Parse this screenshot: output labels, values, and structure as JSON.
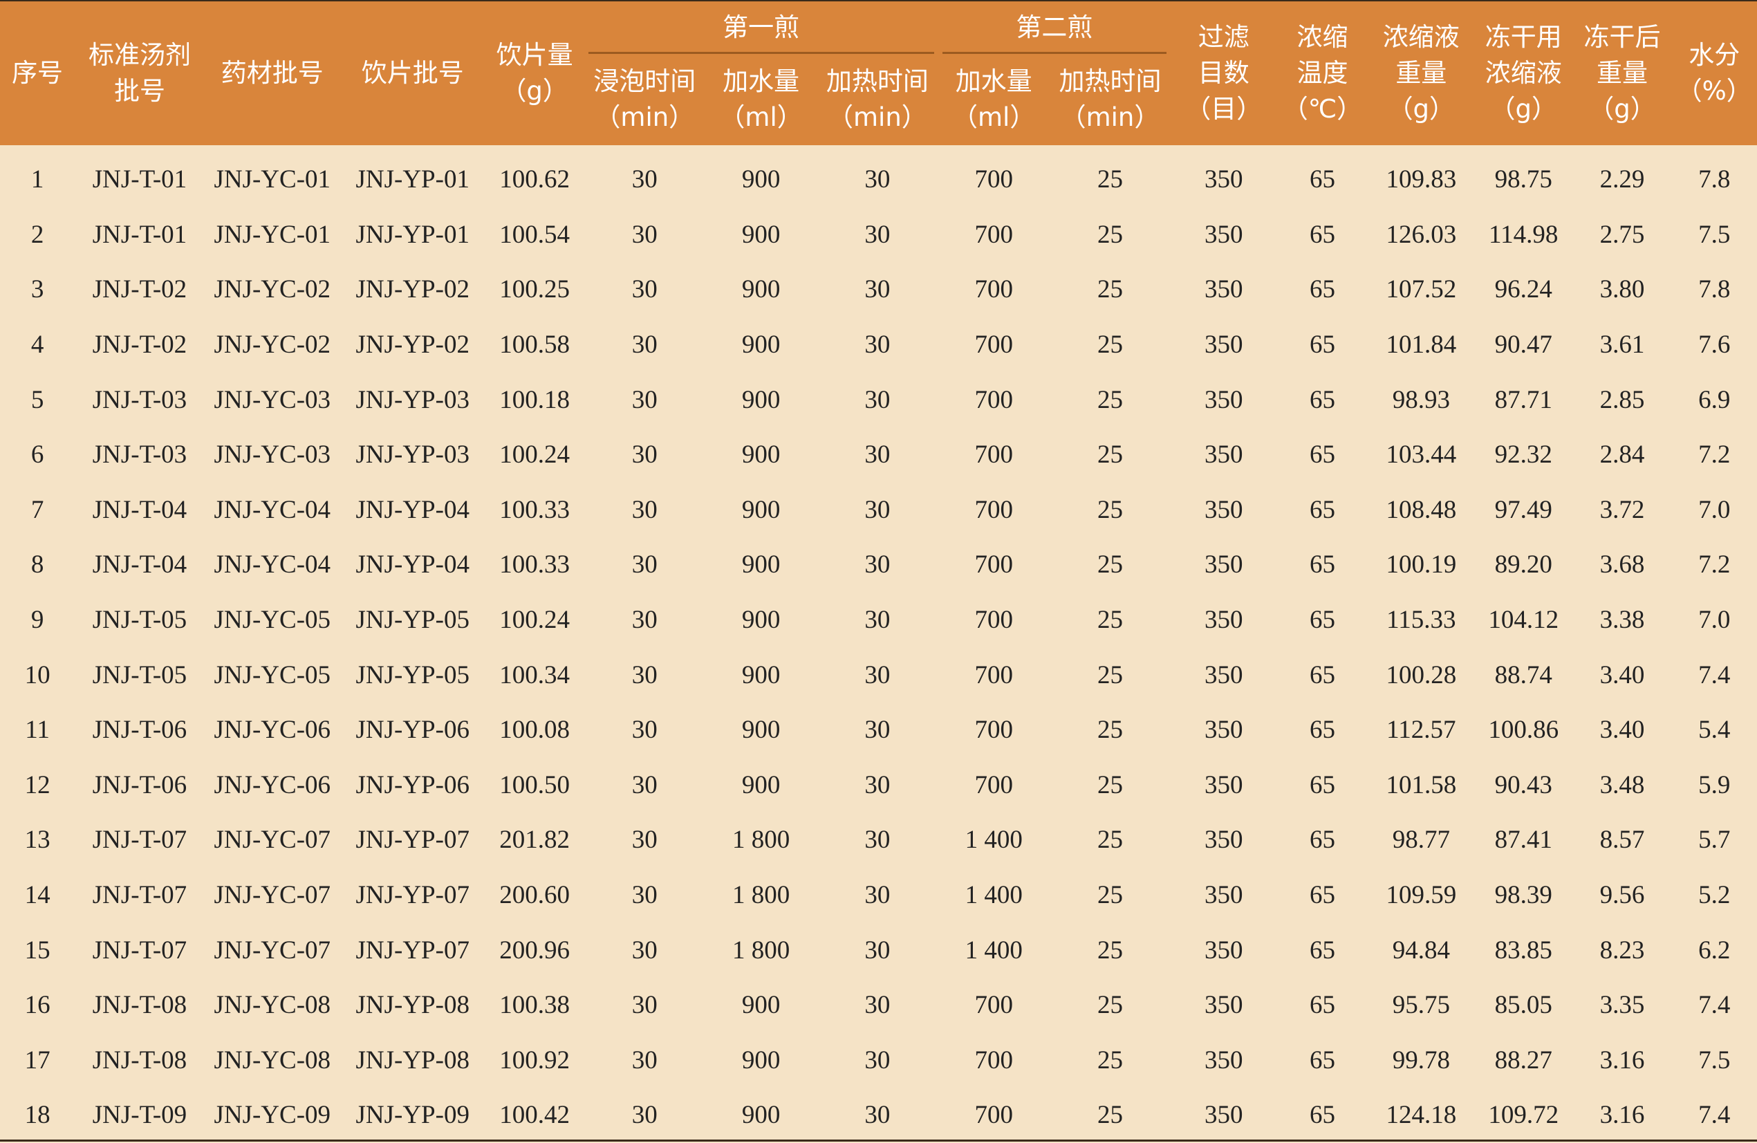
{
  "header": {
    "seq": "序号",
    "std_batch": [
      "标准汤剂",
      "批号"
    ],
    "herb_batch": "药材批号",
    "slice_batch": "饮片批号",
    "slice_amount": [
      "饮片量",
      "（g）"
    ],
    "first_decoction": "第一煎",
    "second_decoction": "第二煎",
    "soak_time": [
      "浸泡时间",
      "（min）"
    ],
    "water1": [
      "加水量",
      "（ml）"
    ],
    "heat1": [
      "加热时间",
      "（min）"
    ],
    "water2": [
      "加水量",
      "（ml）"
    ],
    "heat2": [
      "加热时间",
      "（min）"
    ],
    "filter_mesh": [
      "过滤",
      "目数",
      "（目）"
    ],
    "conc_temp": [
      "浓缩",
      "温度",
      "（℃）"
    ],
    "conc_weight": [
      "浓缩液",
      "重量",
      "（g）"
    ],
    "freeze_conc": [
      "冻干用",
      "浓缩液",
      "（g）"
    ],
    "after_freeze": [
      "冻干后",
      "重量",
      "（g）"
    ],
    "moisture": [
      "水分",
      "（%）"
    ]
  },
  "rows": [
    [
      "1",
      "JNJ-T-01",
      "JNJ-YC-01",
      "JNJ-YP-01",
      "100.62",
      "30",
      "900",
      "30",
      "700",
      "25",
      "350",
      "65",
      "109.83",
      "98.75",
      "2.29",
      "7.8"
    ],
    [
      "2",
      "JNJ-T-01",
      "JNJ-YC-01",
      "JNJ-YP-01",
      "100.54",
      "30",
      "900",
      "30",
      "700",
      "25",
      "350",
      "65",
      "126.03",
      "114.98",
      "2.75",
      "7.5"
    ],
    [
      "3",
      "JNJ-T-02",
      "JNJ-YC-02",
      "JNJ-YP-02",
      "100.25",
      "30",
      "900",
      "30",
      "700",
      "25",
      "350",
      "65",
      "107.52",
      "96.24",
      "3.80",
      "7.8"
    ],
    [
      "4",
      "JNJ-T-02",
      "JNJ-YC-02",
      "JNJ-YP-02",
      "100.58",
      "30",
      "900",
      "30",
      "700",
      "25",
      "350",
      "65",
      "101.84",
      "90.47",
      "3.61",
      "7.6"
    ],
    [
      "5",
      "JNJ-T-03",
      "JNJ-YC-03",
      "JNJ-YP-03",
      "100.18",
      "30",
      "900",
      "30",
      "700",
      "25",
      "350",
      "65",
      "98.93",
      "87.71",
      "2.85",
      "6.9"
    ],
    [
      "6",
      "JNJ-T-03",
      "JNJ-YC-03",
      "JNJ-YP-03",
      "100.24",
      "30",
      "900",
      "30",
      "700",
      "25",
      "350",
      "65",
      "103.44",
      "92.32",
      "2.84",
      "7.2"
    ],
    [
      "7",
      "JNJ-T-04",
      "JNJ-YC-04",
      "JNJ-YP-04",
      "100.33",
      "30",
      "900",
      "30",
      "700",
      "25",
      "350",
      "65",
      "108.48",
      "97.49",
      "3.72",
      "7.0"
    ],
    [
      "8",
      "JNJ-T-04",
      "JNJ-YC-04",
      "JNJ-YP-04",
      "100.33",
      "30",
      "900",
      "30",
      "700",
      "25",
      "350",
      "65",
      "100.19",
      "89.20",
      "3.68",
      "7.2"
    ],
    [
      "9",
      "JNJ-T-05",
      "JNJ-YC-05",
      "JNJ-YP-05",
      "100.24",
      "30",
      "900",
      "30",
      "700",
      "25",
      "350",
      "65",
      "115.33",
      "104.12",
      "3.38",
      "7.0"
    ],
    [
      "10",
      "JNJ-T-05",
      "JNJ-YC-05",
      "JNJ-YP-05",
      "100.34",
      "30",
      "900",
      "30",
      "700",
      "25",
      "350",
      "65",
      "100.28",
      "88.74",
      "3.40",
      "7.4"
    ],
    [
      "11",
      "JNJ-T-06",
      "JNJ-YC-06",
      "JNJ-YP-06",
      "100.08",
      "30",
      "900",
      "30",
      "700",
      "25",
      "350",
      "65",
      "112.57",
      "100.86",
      "3.40",
      "5.4"
    ],
    [
      "12",
      "JNJ-T-06",
      "JNJ-YC-06",
      "JNJ-YP-06",
      "100.50",
      "30",
      "900",
      "30",
      "700",
      "25",
      "350",
      "65",
      "101.58",
      "90.43",
      "3.48",
      "5.9"
    ],
    [
      "13",
      "JNJ-T-07",
      "JNJ-YC-07",
      "JNJ-YP-07",
      "201.82",
      "30",
      "1 800",
      "30",
      "1 400",
      "25",
      "350",
      "65",
      "98.77",
      "87.41",
      "8.57",
      "5.7"
    ],
    [
      "14",
      "JNJ-T-07",
      "JNJ-YC-07",
      "JNJ-YP-07",
      "200.60",
      "30",
      "1 800",
      "30",
      "1 400",
      "25",
      "350",
      "65",
      "109.59",
      "98.39",
      "9.56",
      "5.2"
    ],
    [
      "15",
      "JNJ-T-07",
      "JNJ-YC-07",
      "JNJ-YP-07",
      "200.96",
      "30",
      "1 800",
      "30",
      "1 400",
      "25",
      "350",
      "65",
      "94.84",
      "83.85",
      "8.23",
      "6.2"
    ],
    [
      "16",
      "JNJ-T-08",
      "JNJ-YC-08",
      "JNJ-YP-08",
      "100.38",
      "30",
      "900",
      "30",
      "700",
      "25",
      "350",
      "65",
      "95.75",
      "85.05",
      "3.35",
      "7.4"
    ],
    [
      "17",
      "JNJ-T-08",
      "JNJ-YC-08",
      "JNJ-YP-08",
      "100.92",
      "30",
      "900",
      "30",
      "700",
      "25",
      "350",
      "65",
      "99.78",
      "88.27",
      "3.16",
      "7.5"
    ],
    [
      "18",
      "JNJ-T-09",
      "JNJ-YC-09",
      "JNJ-YP-09",
      "100.42",
      "30",
      "900",
      "30",
      "700",
      "25",
      "350",
      "65",
      "124.18",
      "109.72",
      "3.16",
      "7.4"
    ]
  ]
}
